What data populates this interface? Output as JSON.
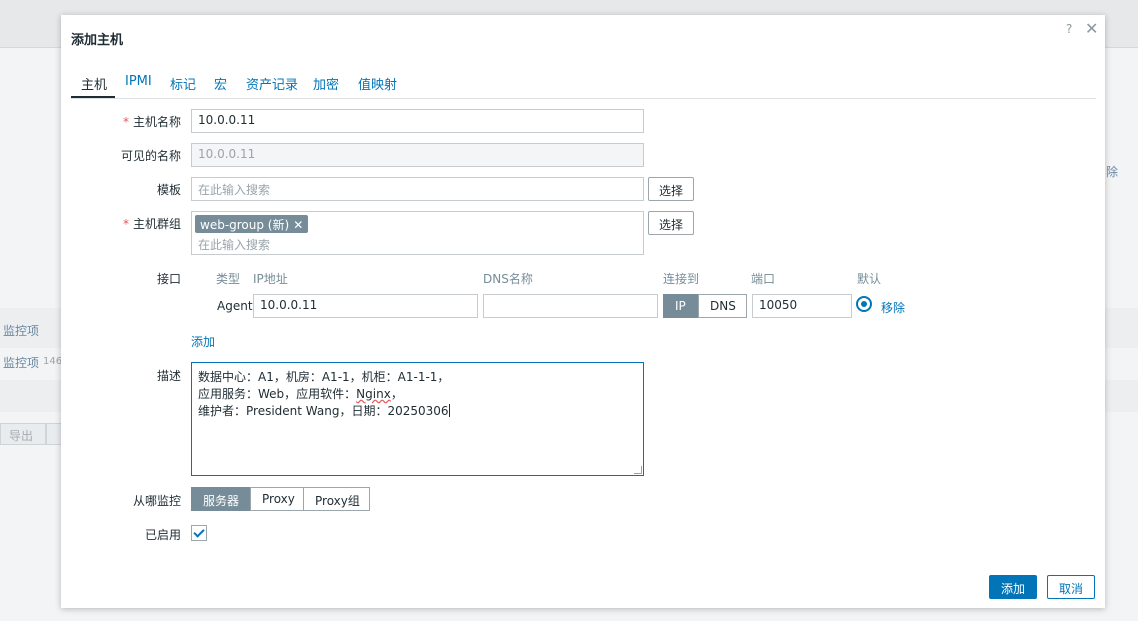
{
  "background": {
    "right_link": "除",
    "row1": "监控项",
    "row2": "监控项",
    "row2_count": "146",
    "export_button": "导出"
  },
  "dialog": {
    "title": "添加主机",
    "help": "?",
    "close": "✕"
  },
  "tabs": [
    {
      "label": "主机",
      "active": true
    },
    {
      "label": "IPMI"
    },
    {
      "label": "标记"
    },
    {
      "label": "宏"
    },
    {
      "label": "资产记录"
    },
    {
      "label": "加密"
    },
    {
      "label": "值映射"
    }
  ],
  "form": {
    "host_name_label": "主机名称",
    "host_name_value": "10.0.0.11",
    "visible_name_label": "可见的名称",
    "visible_name_placeholder": "10.0.0.11",
    "templates_label": "模板",
    "templates_placeholder": "在此输入搜索",
    "select_button": "选择",
    "host_groups_label": "主机群组",
    "host_group_chip": "web-group (新)",
    "host_groups_placeholder": "在此输入搜索",
    "required_mark": "*"
  },
  "interfaces": {
    "label": "接口",
    "headers": {
      "type": "类型",
      "ip": "IP地址",
      "dns": "DNS名称",
      "connect": "连接到",
      "port": "端口",
      "default": "默认"
    },
    "row": {
      "type": "Agent",
      "ip": "10.0.0.11",
      "dns": "",
      "connect_ip": "IP",
      "connect_dns": "DNS",
      "port": "10050",
      "remove": "移除"
    },
    "add_link": "添加"
  },
  "description": {
    "label": "描述",
    "lines": [
      "数据中心：A1，机房：A1-1，机柜：A1-1-1，",
      "应用服务：Web，应用软件：",
      "Nginx",
      "，",
      "维护者：President Wang，日期：20250306"
    ]
  },
  "monitored_by": {
    "label": "从哪监控",
    "options": [
      "服务器",
      "Proxy",
      "Proxy组"
    ],
    "selected": "服务器"
  },
  "enabled": {
    "label": "已启用",
    "checked": true
  },
  "footer": {
    "add_button": "添加",
    "cancel_button": "取消"
  },
  "colors": {
    "accent": "#0275b8",
    "required": "#e45959",
    "segment_on": "#768d99"
  }
}
